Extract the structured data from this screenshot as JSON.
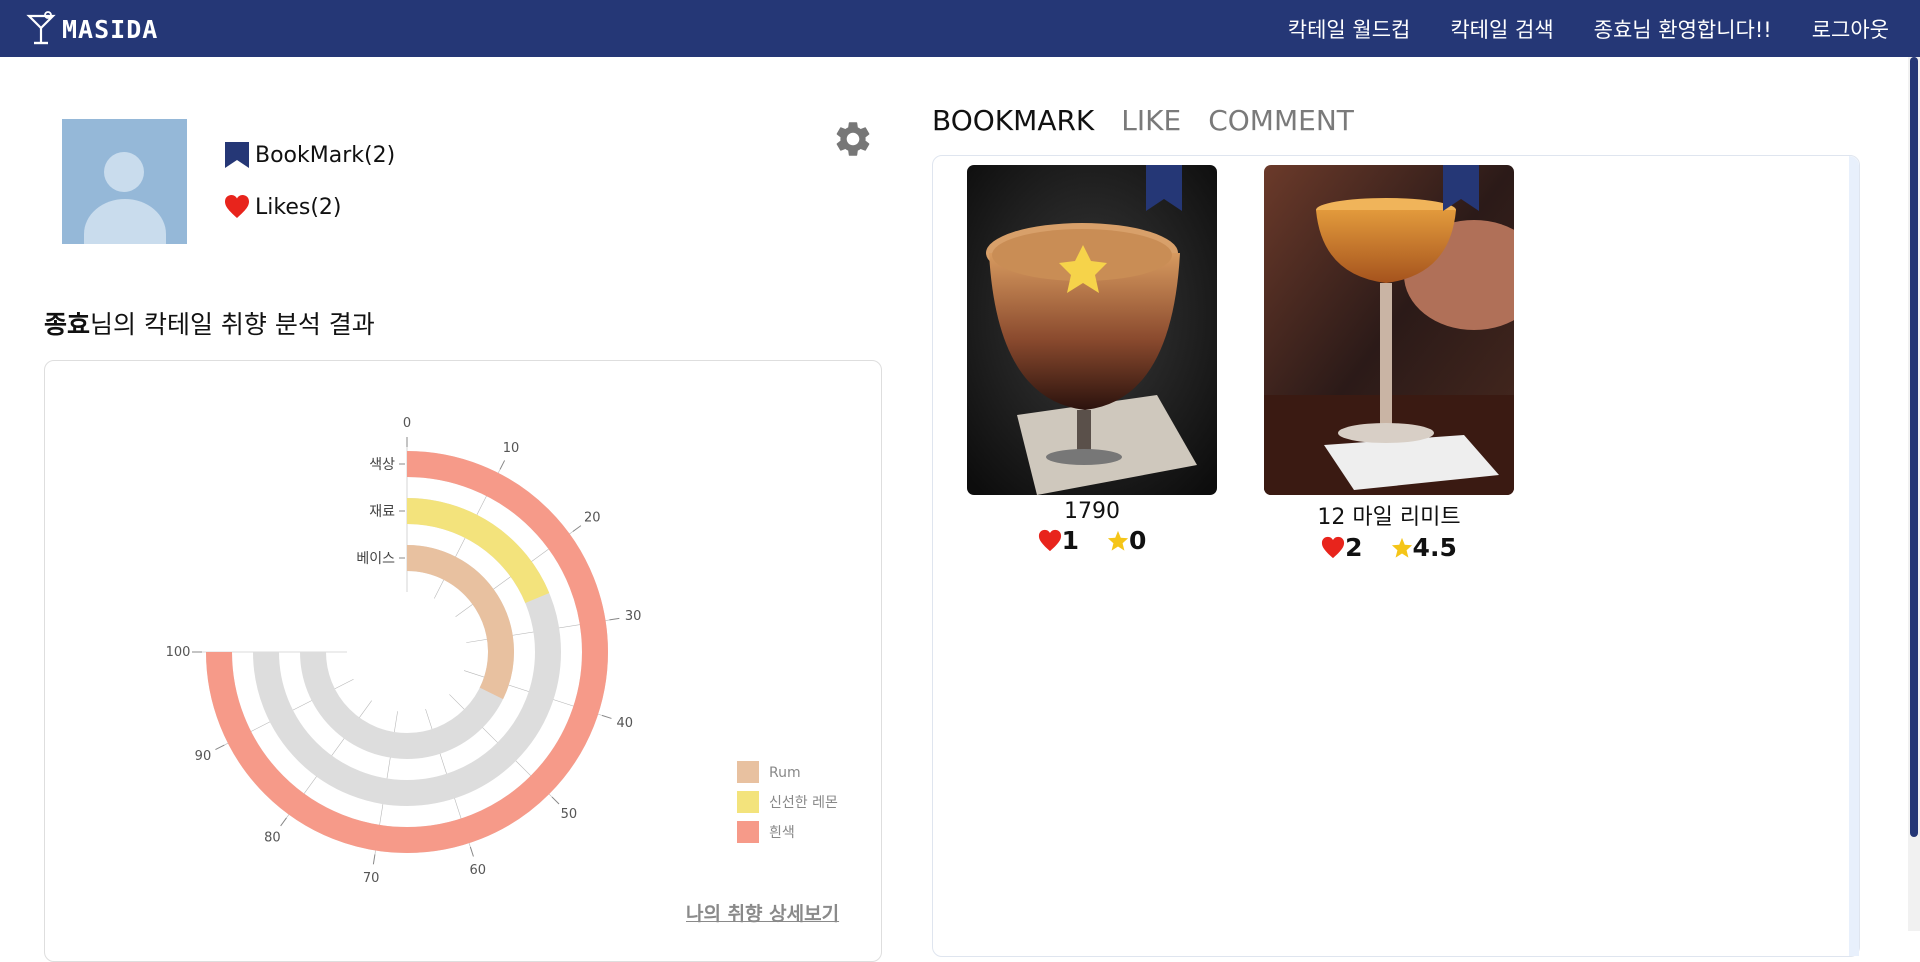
{
  "app": {
    "brand": "MASIDA"
  },
  "nav": {
    "worldcup": "칵테일 월드컵",
    "search": "칵테일 검색",
    "welcome": "종효님 환영합니다!!",
    "logout": "로그아웃"
  },
  "profile": {
    "bookmark_stat": "BookMark(2)",
    "likes_stat": "Likes(2)"
  },
  "analysis": {
    "user_name": "종효",
    "title_suffix": "님의 칵테일 취향 분석 결과",
    "detail_link": "나의 취향 상세보기"
  },
  "chart_data": {
    "type": "radial-bar",
    "categories": [
      "색상",
      "재료",
      "베이스"
    ],
    "values": [
      100,
      25,
      43
    ],
    "series_labels": [
      "흰색",
      "신선한 레몬",
      "Rum"
    ],
    "ticks": [
      "0",
      "10",
      "20",
      "30",
      "40",
      "50",
      "60",
      "70",
      "80",
      "90",
      "100"
    ],
    "range": [
      0,
      100
    ],
    "legend": [
      {
        "name": "Rum",
        "color": "#e8c1a0"
      },
      {
        "name": "신선한 레몬",
        "color": "#f3e37c"
      },
      {
        "name": "흰색",
        "color": "#f69a89"
      }
    ],
    "legend_placement": "bottom-right"
  },
  "tabs": {
    "bookmark": "BOOKMARK",
    "like": "LIKE",
    "comment": "COMMENT"
  },
  "cards": [
    {
      "name": "1790",
      "likes": "1",
      "rating": "0"
    },
    {
      "name": "12 마일 리미트",
      "likes": "2",
      "rating": "4.5"
    }
  ],
  "colors": {
    "nav": "#253776",
    "heart": "#e8241c",
    "star": "#f5c518",
    "bookmark": "#253776"
  }
}
